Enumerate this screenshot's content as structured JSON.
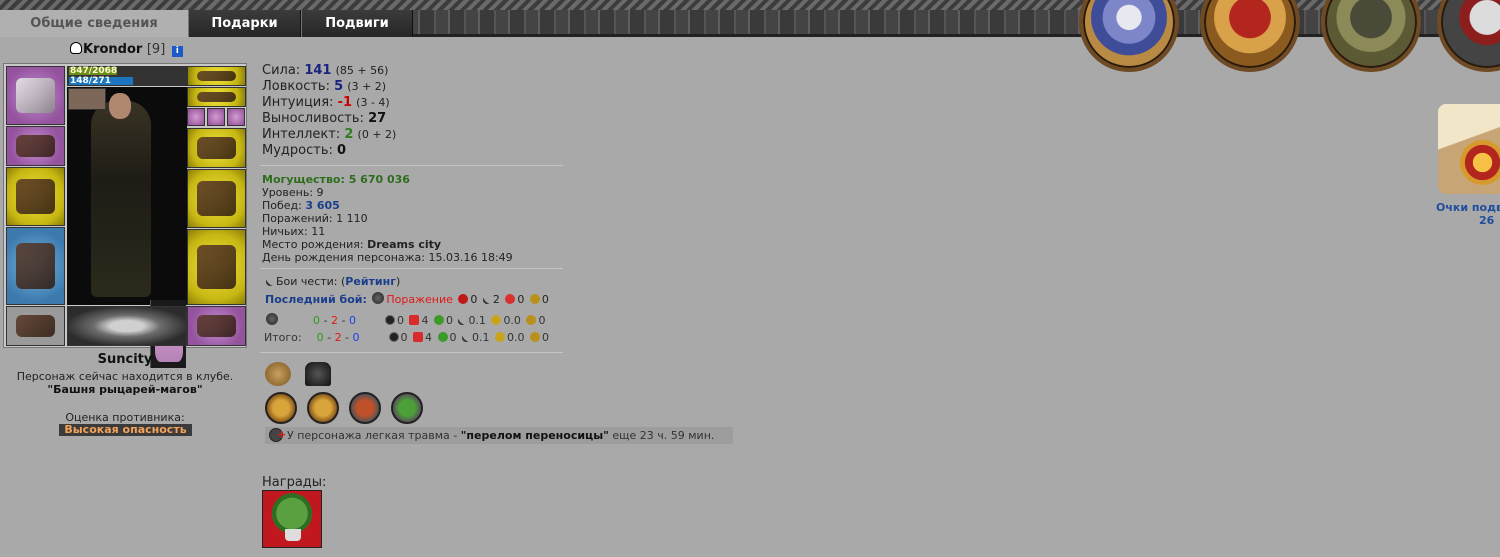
{
  "tabs": [
    {
      "label": "Общие сведения"
    },
    {
      "label": "Подарки"
    },
    {
      "label": "Подвиги"
    }
  ],
  "character": {
    "name": "Krondor",
    "level": "[9]",
    "info": "i",
    "hp_text": "847/2068",
    "mp_text": "148/271",
    "hp_fraction": 0.41,
    "mp_fraction": 0.55,
    "city": "Suncity",
    "club_line": "Персонаж сейчас находится в клубе.",
    "club_name": "\"Башня рыцарей-магов\"",
    "danger_label": "Оценка противника:",
    "danger_value": "Высокая опасность"
  },
  "stats": [
    {
      "label": "Сила: ",
      "value": "141",
      "extra": "(85 + 56)",
      "color": "blue"
    },
    {
      "label": "Ловкость: ",
      "value": "5",
      "extra": "(3 + 2)",
      "color": "blue"
    },
    {
      "label": "Интуиция: ",
      "value": "-1",
      "extra": "(3 - 4)",
      "color": "red"
    },
    {
      "label": "Выносливость: ",
      "value": "27",
      "extra": "",
      "color": "black"
    },
    {
      "label": "Интеллект: ",
      "value": "2",
      "extra": "(0 + 2)",
      "color": "green"
    },
    {
      "label": "Мудрость: ",
      "value": "0",
      "extra": "",
      "color": "black"
    }
  ],
  "info": {
    "power_label": "Могущество: ",
    "power_value": "5 670 036",
    "level_label": "Уровень: ",
    "level_value": "9",
    "wins_label": "Побед: ",
    "wins_value": "3 605",
    "losses_label": "Поражений: ",
    "losses_value": "1 110",
    "draws_label": "Ничьих: ",
    "draws_value": "11",
    "birthplace_label": "Место рождения: ",
    "birthplace_value": "Dreams city",
    "birthday_label": "День рождения персонажа: ",
    "birthday_value": "15.03.16 18:49"
  },
  "honor": {
    "label": "Бои чести: (",
    "link": "Рейтинг",
    "close": ")",
    "last_label": "Последний бой:",
    "last_result": "Поражение",
    "last_skull": "0",
    "last_sword": "2",
    "last_cross": "0",
    "last_shield": "0"
  },
  "totals": [
    {
      "label": "",
      "w": "0",
      "l": "2",
      "d": "0",
      "a": "0",
      "b": "4",
      "c": "0",
      "e": "0.1",
      "f": "0.0",
      "h": "0"
    },
    {
      "label": "Итого:",
      "w": "0",
      "l": "2",
      "d": "0",
      "a": "0",
      "b": "4",
      "c": "0",
      "e": "0.1",
      "f": "0.0",
      "h": "0"
    }
  ],
  "trauma": {
    "prefix": "У персонажа легкая травма - ",
    "name": "\"перелом переносицы\"",
    "suffix": " еще 23 ч. 59 мин."
  },
  "awards_label": "Награды:",
  "points": {
    "label": "Очки подв",
    "value": "26"
  }
}
